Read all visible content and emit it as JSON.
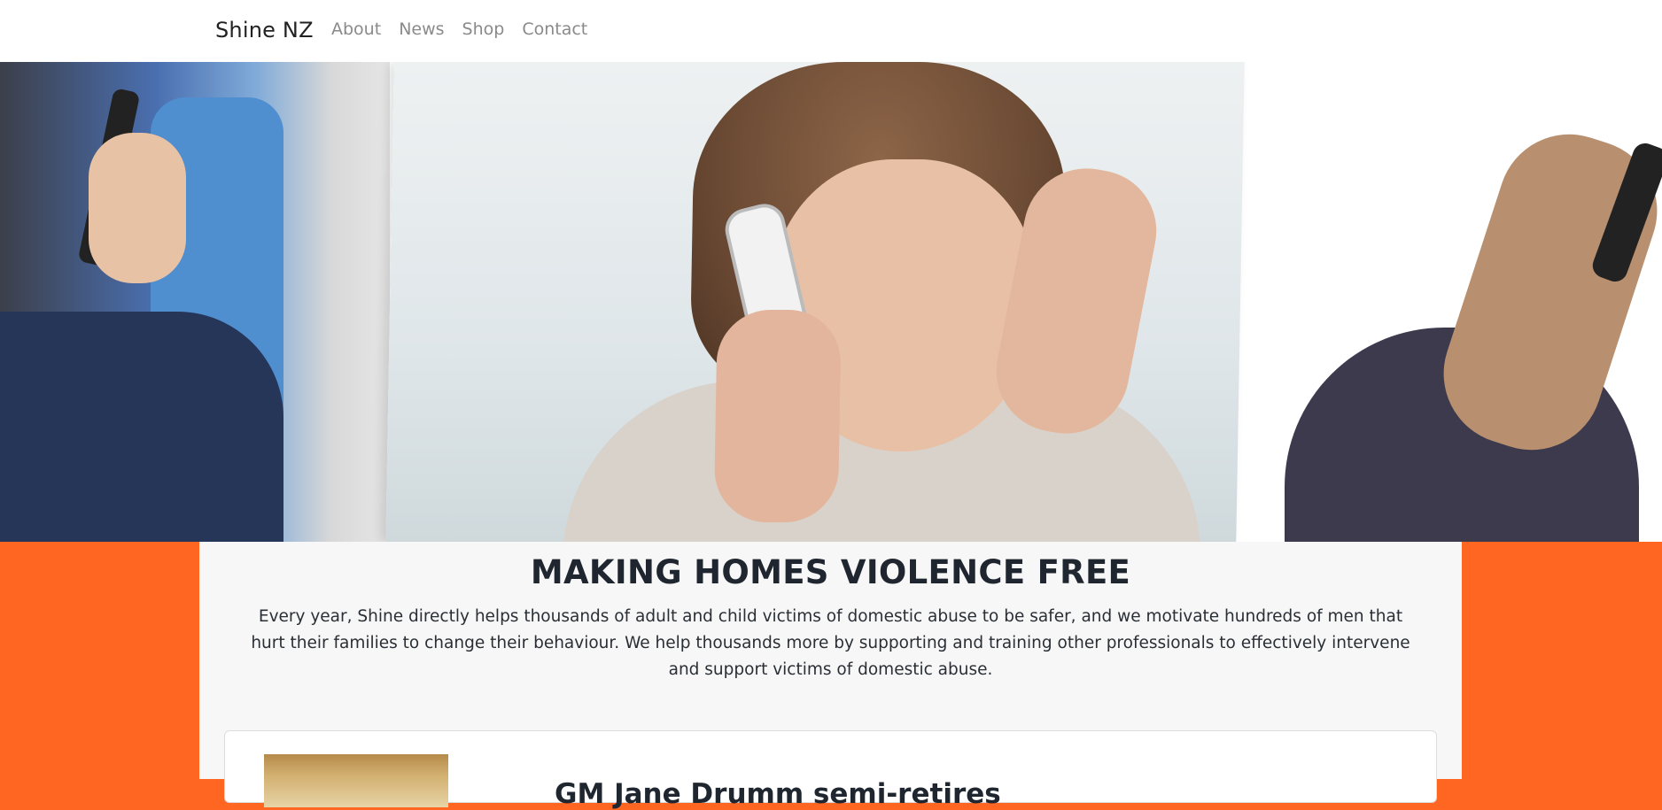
{
  "nav": {
    "brand": "Shine NZ",
    "links": [
      "About",
      "News",
      "Shop",
      "Contact"
    ]
  },
  "hero": {
    "image_alt": "Person on phone, distressed"
  },
  "main": {
    "heading": "MAKING HOMES VIOLENCE FREE",
    "intro": "Every year, Shine directly helps thousands of adult and child victims of domestic abuse to be safer, and we motivate hundreds of men that hurt their families to change their behaviour. We help thousands more by supporting and training other professionals to effectively intervene and support victims of domestic abuse.",
    "news_card": {
      "title": "GM Jane Drumm semi-retires"
    }
  },
  "colors": {
    "accent": "#ff6622",
    "content_bg": "#f7f7f7",
    "nav_link": "#8a8a8a"
  }
}
